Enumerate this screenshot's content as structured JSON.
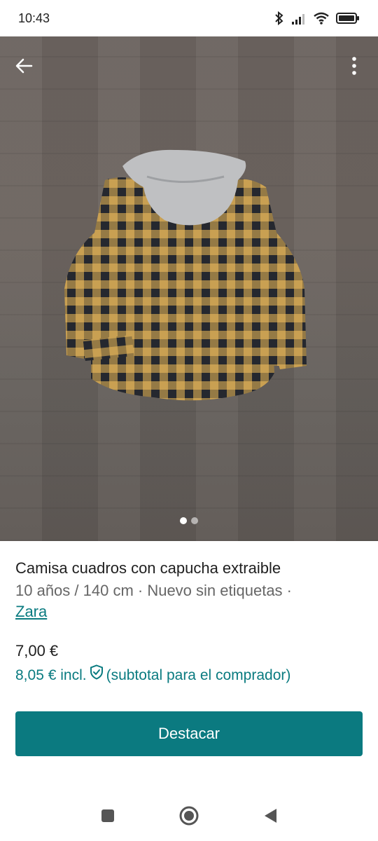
{
  "status": {
    "time": "10:43"
  },
  "carousel": {
    "count": 2,
    "active": 0
  },
  "listing": {
    "title": "Camisa cuadros con capucha extraible",
    "details": "10 años / 140 cm · Nuevo sin etiquetas ·",
    "brand": "Zara",
    "price": "7,00 €",
    "price_incl": "8,05 € incl.",
    "price_incl_note": "(subtotal para el comprador)"
  },
  "actions": {
    "feature_label": "Destacar"
  },
  "colors": {
    "accent": "#0b7a80",
    "price_incl": "#0a7b80"
  },
  "icons": {
    "back": "back-arrow-icon",
    "more": "more-vert-icon",
    "shield": "shield-check-icon",
    "nav_recent": "square-icon",
    "nav_home": "circle-icon",
    "nav_back": "triangle-back-icon"
  }
}
